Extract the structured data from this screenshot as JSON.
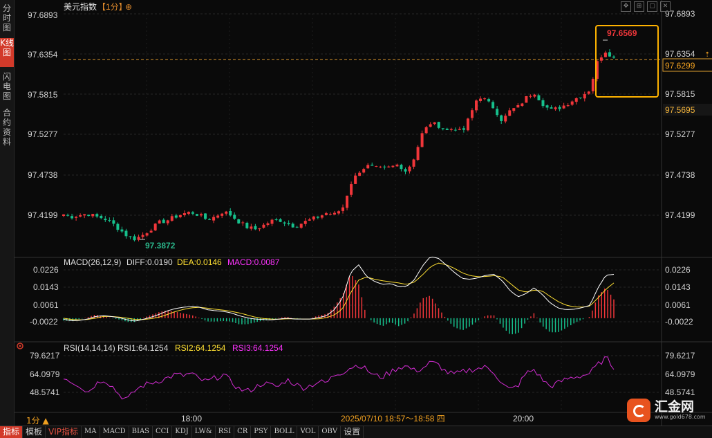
{
  "sidebar": {
    "tabs": [
      "分时图",
      "K线图",
      "闪电图",
      "合约资料"
    ],
    "active": 1
  },
  "header": {
    "title": "美元指数",
    "period_badge": "【1分】",
    "add_icon": "⊕"
  },
  "toolbar_icons": [
    "move-icon",
    "zoom-icon",
    "fullscreen-icon",
    "close-icon"
  ],
  "price_axis": {
    "ticks": [
      "97.6893",
      "97.6354",
      "97.5815",
      "97.5277",
      "97.4738",
      "97.4199"
    ]
  },
  "price_labels": {
    "current": "97.6299",
    "crosshair": "97.5695"
  },
  "annotations": {
    "high": "97.6569",
    "low": "97.3872"
  },
  "macd": {
    "header": "MACD(26,12,9)",
    "diff": "DIFF:0.0190",
    "dea": "DEA:0.0146",
    "macd": "MACD:0.0087",
    "ticks": [
      "0.0226",
      "0.0143",
      "0.0061",
      "-0.0022"
    ]
  },
  "rsi": {
    "header": "RSI(14,14,14)",
    "rsi1": "RSI1:64.1254",
    "rsi2": "RSI2:64.1254",
    "rsi3": "RSI3:64.1254",
    "ticks": [
      "79.6217",
      "64.0979",
      "48.5741"
    ]
  },
  "time_axis": {
    "labels": [
      "18:00",
      "20:00"
    ],
    "range_label": "2025/07/10 18:57～18:58 四"
  },
  "period_selector": "1分 ▲",
  "bottom_tabs": [
    "指标",
    "模板",
    "VIP指标",
    "MA",
    "MACD",
    "BIAS",
    "CCI",
    "KDJ",
    "LW&",
    "RSI",
    "CR",
    "PSY",
    "BOLL",
    "VOL",
    "OBV",
    "设置"
  ],
  "logo": {
    "name": "汇金网",
    "url": "www.gold678.com"
  },
  "colors": {
    "up": "#f0363a",
    "down": "#16c08c",
    "diff": "#ffffff",
    "dea": "#ffe033",
    "macd_label": "#ff33ff",
    "rsi_line": "#d22cd2",
    "highlight": "#ffb300"
  },
  "chart_data": {
    "type": "candlestick",
    "close_path": [
      97.421,
      97.418,
      97.42,
      97.422,
      97.418,
      97.416,
      97.41,
      97.401,
      97.392,
      97.388,
      97.394,
      97.402,
      97.41,
      97.413,
      97.418,
      97.422,
      97.424,
      97.42,
      97.414,
      97.418,
      97.425,
      97.42,
      97.411,
      97.404,
      97.401,
      97.406,
      97.412,
      97.414,
      97.409,
      97.405,
      97.41,
      97.414,
      97.418,
      97.423,
      97.421,
      97.43,
      97.462,
      97.478,
      97.486,
      97.483,
      97.482,
      97.484,
      97.488,
      97.478,
      97.498,
      97.53,
      97.543,
      97.54,
      97.533,
      97.537,
      97.53,
      97.554,
      97.58,
      97.573,
      97.563,
      97.546,
      97.56,
      97.565,
      97.577,
      97.585,
      97.57,
      97.56,
      97.563,
      97.568,
      97.575,
      97.58,
      97.588,
      97.628,
      97.64,
      97.63
    ],
    "diff_path": [
      -0.0005,
      -0.0012,
      -0.001,
      -0.0004,
      0.0008,
      0.0012,
      0.0008,
      0.0002,
      -0.0008,
      -0.0014,
      -0.0005,
      0.0005,
      0.0018,
      0.0034,
      0.0045,
      0.0051,
      0.0055,
      0.0052,
      0.004,
      0.0035,
      0.0032,
      0.0025,
      0.0012,
      0.0002,
      -0.0004,
      -0.0006,
      -0.0008,
      -0.0004,
      0.0,
      -0.0004,
      -0.0004,
      -0.0004,
      0.0003,
      0.0012,
      0.0042,
      0.0095,
      0.0215,
      0.025,
      0.0195,
      0.0172,
      0.0158,
      0.0162,
      0.0148,
      0.0148,
      0.018,
      0.0244,
      0.0288,
      0.028,
      0.0248,
      0.0214,
      0.0186,
      0.0182,
      0.0189,
      0.0201,
      0.0205,
      0.0175,
      0.0128,
      0.01,
      0.0115,
      0.0142,
      0.0112,
      0.0072,
      0.0048,
      0.004,
      0.0042,
      0.0049,
      0.006,
      0.0141,
      0.0201,
      0.0205
    ],
    "dea_path": [
      0.0,
      -0.0006,
      -0.0008,
      -0.0006,
      0.0,
      0.0008,
      0.0008,
      0.0005,
      0.0,
      -0.0006,
      -0.0006,
      -0.0002,
      0.0005,
      0.0017,
      0.0031,
      0.0041,
      0.0048,
      0.0051,
      0.0047,
      0.0042,
      0.0038,
      0.0032,
      0.0025,
      0.0015,
      0.0005,
      -0.0001,
      -0.0004,
      -0.0005,
      -0.0003,
      -0.0003,
      -0.0004,
      -0.0004,
      -0.0003,
      0.0003,
      0.0016,
      0.0045,
      0.012,
      0.0178,
      0.0193,
      0.0182,
      0.0175,
      0.017,
      0.0165,
      0.0158,
      0.0169,
      0.0202,
      0.024,
      0.0258,
      0.025,
      0.0233,
      0.0212,
      0.0199,
      0.0194,
      0.0195,
      0.0199,
      0.0193,
      0.0163,
      0.0132,
      0.0122,
      0.0131,
      0.0128,
      0.0102,
      0.0078,
      0.0061,
      0.0053,
      0.0052,
      0.0057,
      0.0094,
      0.0135,
      0.0165
    ],
    "rsi_path": [
      62,
      58,
      55,
      49,
      56,
      60,
      55,
      47,
      43,
      51,
      55,
      57,
      59,
      61,
      64,
      63,
      65,
      60,
      58,
      61,
      64,
      58,
      52,
      50,
      53,
      57,
      55,
      54,
      60,
      56,
      53,
      55,
      58,
      57,
      64,
      66,
      70,
      72,
      68,
      63,
      62,
      66,
      70,
      71,
      67,
      69,
      74,
      72,
      66,
      64,
      66,
      68,
      69,
      70,
      66,
      56,
      51,
      55,
      65,
      68,
      60,
      54,
      57,
      60,
      62,
      63,
      65,
      72,
      78,
      70
    ]
  }
}
